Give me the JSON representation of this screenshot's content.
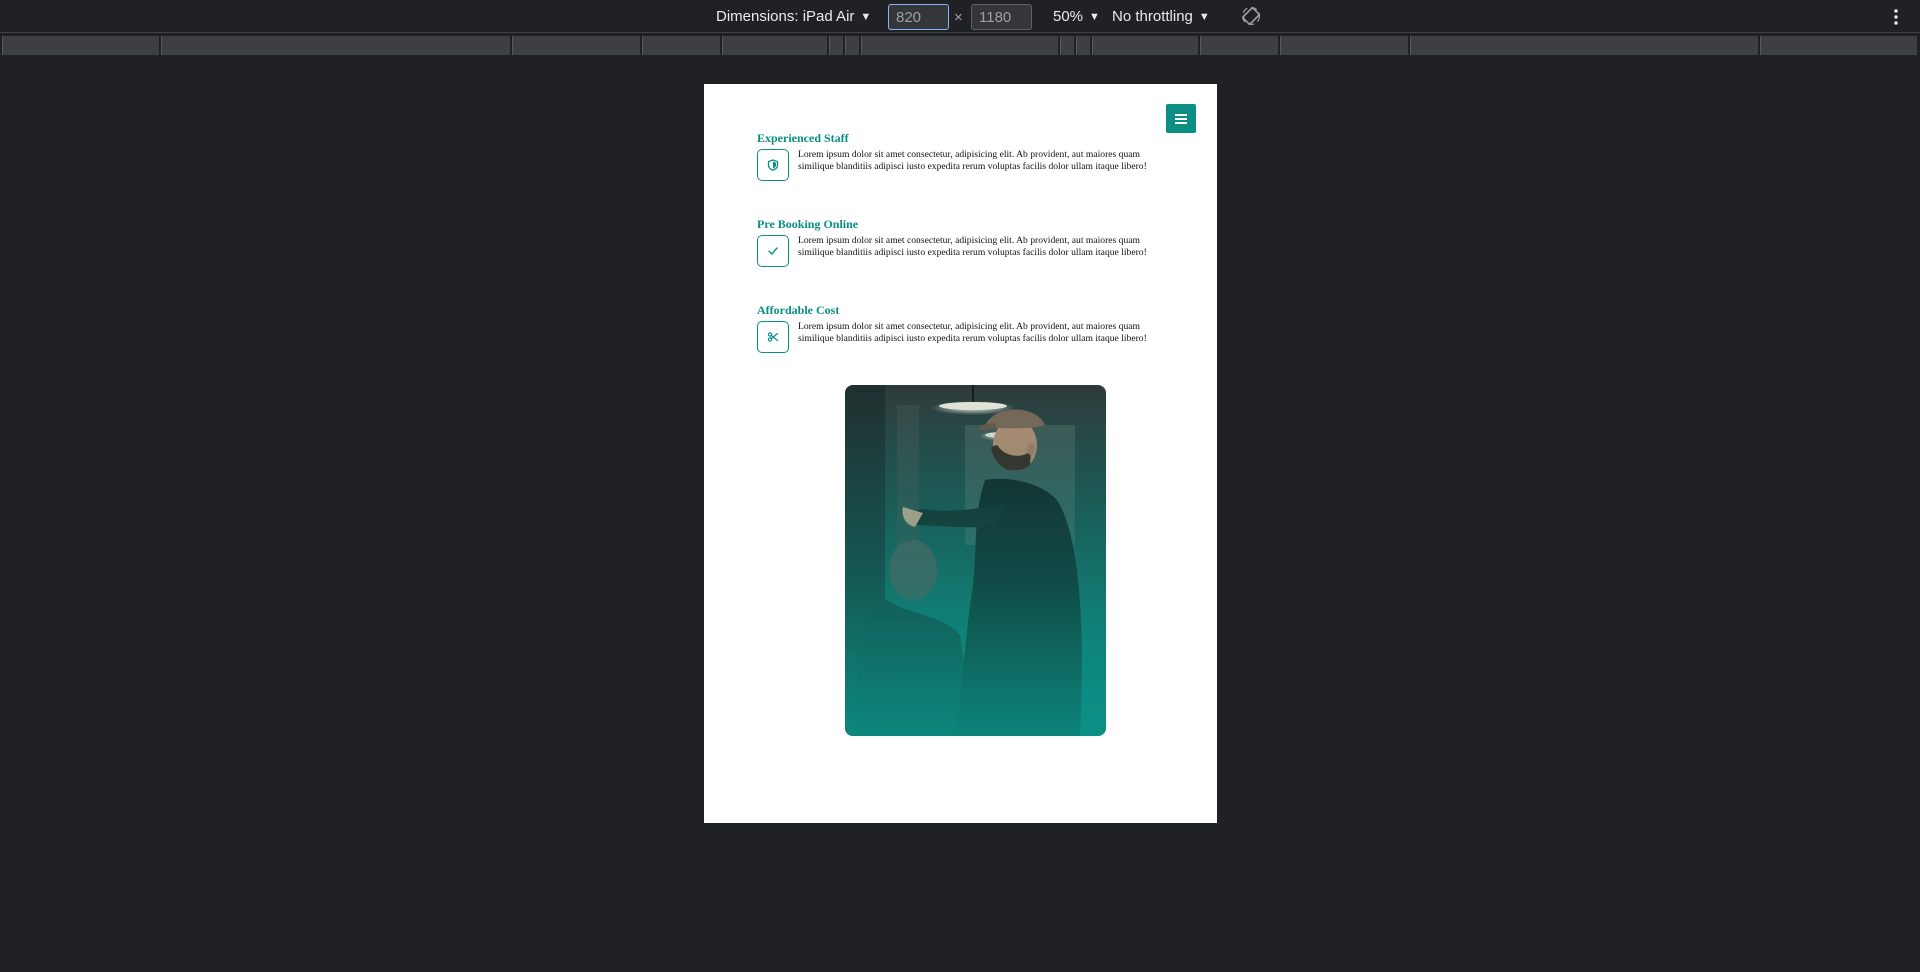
{
  "toolbar": {
    "dimensions_label": "Dimensions: iPad Air",
    "width_value": "820",
    "height_value": "1180",
    "times": "×",
    "zoom_label": "50%",
    "throttling_label": "No throttling"
  },
  "features": [
    {
      "title": "Experienced Staff",
      "icon": "shield-icon",
      "text": "Lorem ipsum dolor sit amet consectetur, adipisicing elit. Ab provident, aut maiores quam similique blanditiis adipisci iusto expedita rerum voluptas facilis dolor ullam itaque libero!"
    },
    {
      "title": "Pre Booking Online",
      "icon": "check-icon",
      "text": "Lorem ipsum dolor sit amet consectetur, adipisicing elit. Ab provident, aut maiores quam similique blanditiis adipisci iusto expedita rerum voluptas facilis dolor ullam itaque libero!"
    },
    {
      "title": "Affordable Cost",
      "icon": "scissors-icon",
      "text": "Lorem ipsum dolor sit amet consectetur, adipisicing elit. Ab provident, aut maiores quam similique blanditiis adipisci iusto expedita rerum voluptas facilis dolor ullam itaque libero!"
    }
  ],
  "colors": {
    "accent": "#0b8f84",
    "page_bg": "#202124",
    "viewport_bg": "#ffffff"
  }
}
